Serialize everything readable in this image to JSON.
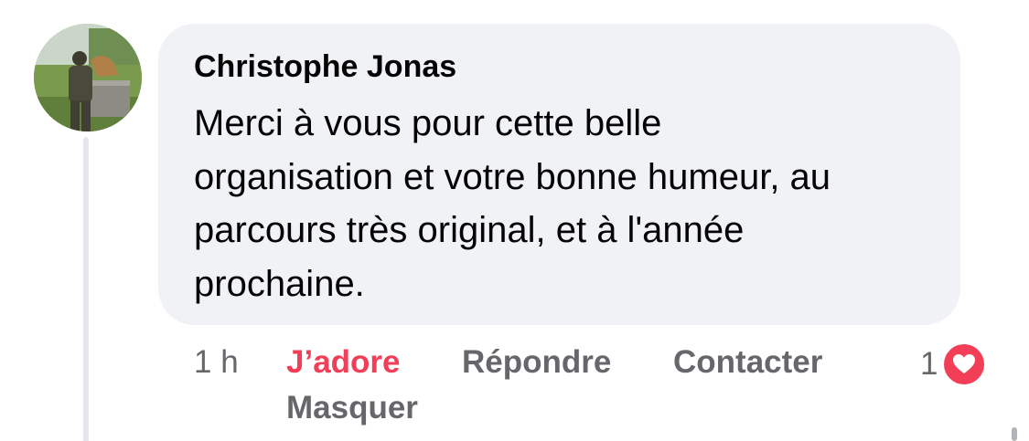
{
  "comment": {
    "author": "Christophe Jonas",
    "text_lines": [
      "Merci à vous pour cette belle",
      "organisation et votre bonne humeur, au",
      "parcours très original, et à l'année",
      "prochaine."
    ],
    "timestamp": "1 h",
    "actions": {
      "adore": "J’adore",
      "reply": "Répondre",
      "contact": "Contacter",
      "hide": "Masquer"
    },
    "reaction_count": "1",
    "reaction_icon": "heart-icon"
  },
  "colors": {
    "bubble_bg": "#f0f2f5",
    "text": "#050505",
    "secondary_text": "#65676b",
    "love_red": "#f33e58"
  }
}
